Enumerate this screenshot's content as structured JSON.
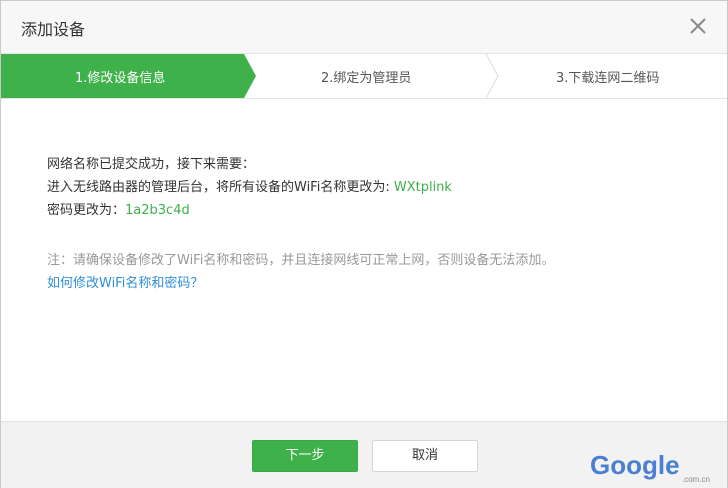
{
  "dialog": {
    "title": "添加设备"
  },
  "steps": [
    {
      "label": "1.修改设备信息",
      "active": true
    },
    {
      "label": "2.绑定为管理员",
      "active": false
    },
    {
      "label": "3.下载连网二维码",
      "active": false
    }
  ],
  "content": {
    "line1": "网络名称已提交成功，接下来需要：",
    "line2_prefix": "进入无线路由器的管理后台，将所有设备的WiFi名称更改为: ",
    "wifi_name": "WXtplink",
    "line3_prefix": "密码更改为：",
    "password": "1a2b3c4d"
  },
  "note": {
    "text": "注：请确保设备修改了WiFi名称和密码，并且连接网线可正常上网，否则设备无法添加。",
    "link": "如何修改WiFi名称和密码？"
  },
  "buttons": {
    "next": "下一步",
    "cancel": "取消"
  },
  "watermark": {
    "brand": "Google",
    "site": ".com.cn"
  },
  "colors": {
    "accent_green": "#3fb14b",
    "link_blue": "#2f8fd8"
  }
}
